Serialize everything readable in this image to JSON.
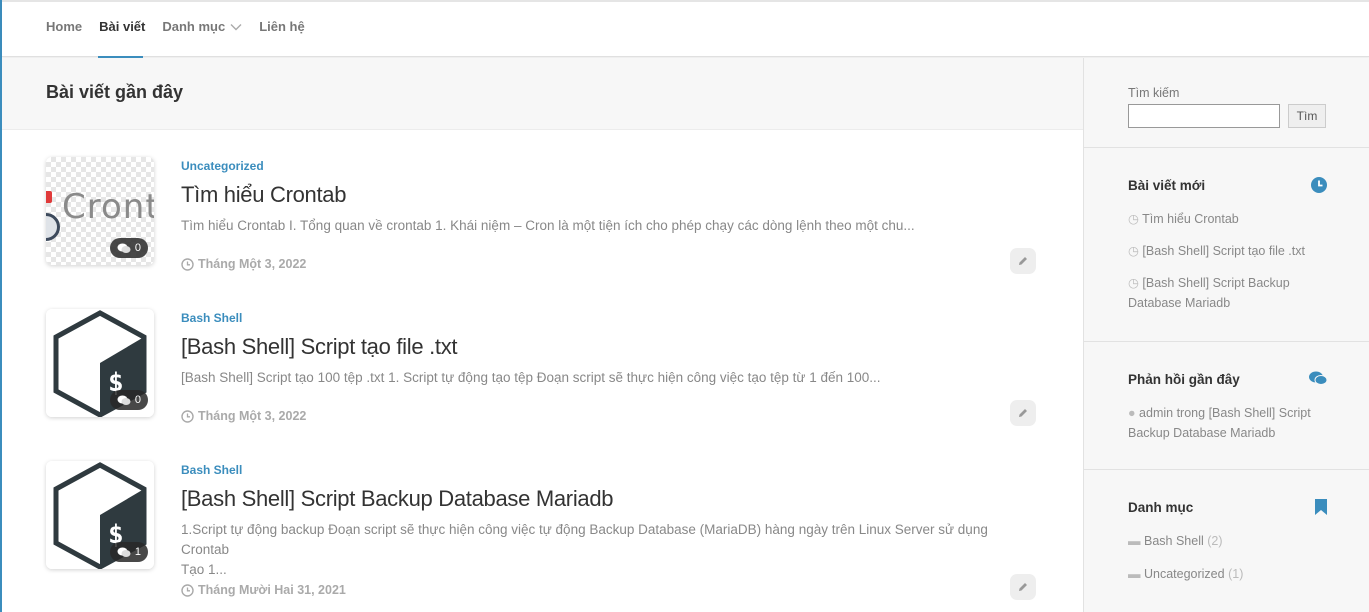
{
  "nav": {
    "items": [
      {
        "label": "Home"
      },
      {
        "label": "Bài viết"
      },
      {
        "label": "Danh mục"
      },
      {
        "label": "Liên hệ"
      }
    ]
  },
  "main": {
    "title": "Bài viết gần đây",
    "posts": [
      {
        "category": "Uncategorized",
        "title": "Tìm hiểu Crontab",
        "excerpt": "Tìm hiểu Crontab  I. Tổng quan về crontab  1. Khái niệm – Cron là một tiện ích cho phép chạy các dòng lệnh theo một chu...",
        "date": "Tháng Một 3, 2022",
        "comments": "0",
        "thumb_text": "Cront"
      },
      {
        "category": "Bash Shell",
        "title": "[Bash Shell] Script tạo file .txt",
        "excerpt": "[Bash Shell] Script tạo 100 tệp .txt 1. Script tự động tạo tệp Đoạn script sẽ thực hiện công việc tạo tệp từ 1 đến 100...",
        "date": "Tháng Một 3, 2022",
        "comments": "0"
      },
      {
        "category": "Bash Shell",
        "title": "[Bash Shell] Script Backup Database Mariadb",
        "excerpt_line1": "1.Script tự động backup Đoạn script sẽ thực hiện công việc tự động Backup Database (MariaDB) hàng ngày trên Linux Server sử dụng Crontab",
        "excerpt_line2": "Tạo 1...",
        "date": "Tháng Mười Hai 31, 2021",
        "comments": "1"
      }
    ]
  },
  "sidebar": {
    "search": {
      "label": "Tìm kiếm",
      "button": "Tìm",
      "value": ""
    },
    "recent_posts": {
      "title": "Bài viết mới",
      "items": [
        {
          "label": "Tìm hiểu Crontab"
        },
        {
          "label": "[Bash Shell] Script tạo file .txt"
        },
        {
          "label": "[Bash Shell] Script Backup",
          "label2": "Database Mariadb"
        }
      ]
    },
    "recent_comments": {
      "title": "Phản hồi gần đây",
      "items": [
        {
          "author": "admin",
          "connector": "trong",
          "post": "[Bash Shell] Script",
          "post2": "Backup Database Mariadb"
        }
      ]
    },
    "categories": {
      "title": "Danh mục",
      "items": [
        {
          "label": "Bash Shell",
          "count": "(2)"
        },
        {
          "label": "Uncategorized",
          "count": "(1)"
        }
      ]
    }
  },
  "colors": {
    "accent": "#3b8dbd",
    "text": "#333333",
    "muted": "#888888"
  }
}
